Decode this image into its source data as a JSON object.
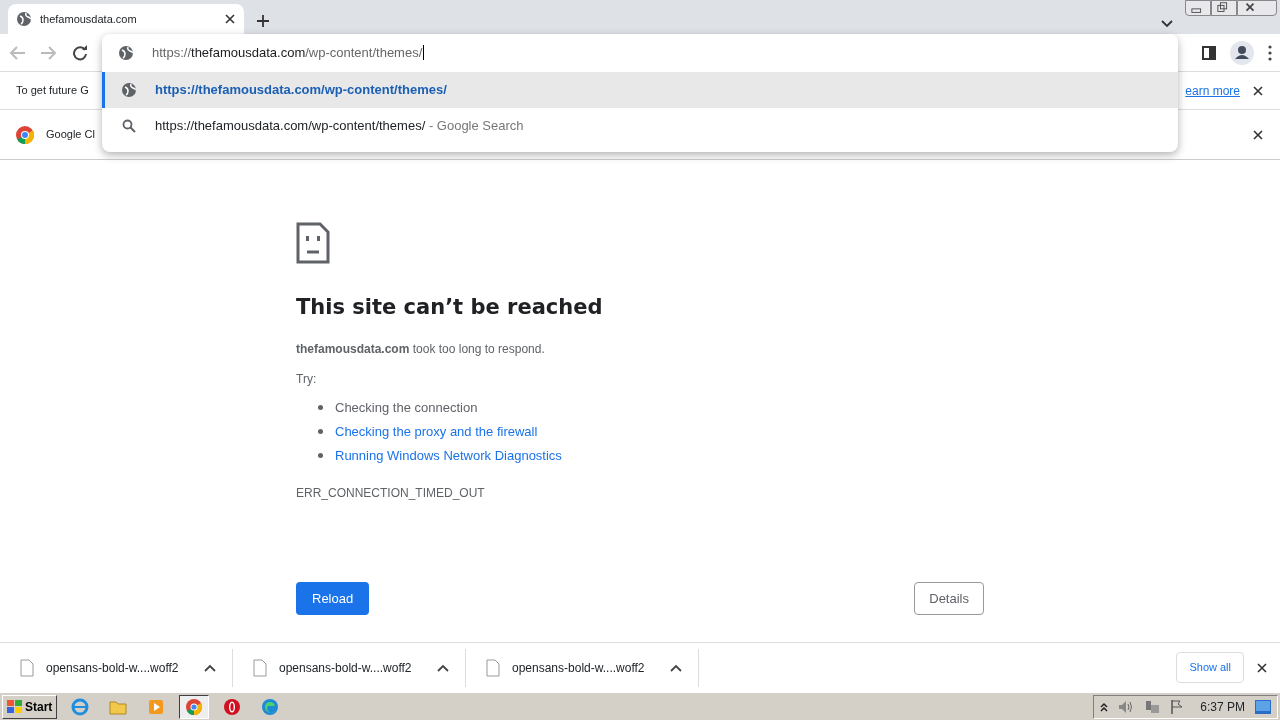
{
  "window": {
    "title": "thefamousdata.com"
  },
  "omnibox": {
    "scheme": "https://",
    "host": "thefamousdata.com",
    "path": "/wp-content/themes/"
  },
  "suggestions": [
    {
      "kind": "url",
      "text": "https://thefamousdata.com/wp-content/themes/",
      "selected": true
    },
    {
      "kind": "search",
      "text": "https://thefamousdata.com/wp-content/themes/",
      "suffix": "- Google Search",
      "selected": false
    }
  ],
  "infobars": [
    {
      "kind": "text",
      "text": "To get future G",
      "link": "earn more"
    },
    {
      "kind": "chrome",
      "text": "Google Cl"
    }
  ],
  "error": {
    "title": "This site can’t be reached",
    "host": "thefamousdata.com",
    "message": "took too long to respond.",
    "try_label": "Try:",
    "tips": [
      {
        "text": "Checking the connection",
        "link": false
      },
      {
        "text": "Checking the proxy and the firewall",
        "link": true
      },
      {
        "text": "Running Windows Network Diagnostics",
        "link": true
      }
    ],
    "code": "ERR_CONNECTION_TIMED_OUT",
    "reload": "Reload",
    "details": "Details"
  },
  "downloads": [
    {
      "name": "opensans-bold-w....woff2"
    },
    {
      "name": "opensans-bold-w....woff2"
    },
    {
      "name": "opensans-bold-w....woff2"
    }
  ],
  "show_all": "Show all",
  "taskbar": {
    "start": "Start",
    "apps": [
      {
        "kind": "ie",
        "active": false
      },
      {
        "kind": "folder",
        "active": false
      },
      {
        "kind": "media",
        "active": false
      },
      {
        "kind": "chrome",
        "active": true
      },
      {
        "kind": "opera",
        "active": false
      },
      {
        "kind": "edge",
        "active": false
      }
    ],
    "time": "6:37 PM"
  }
}
